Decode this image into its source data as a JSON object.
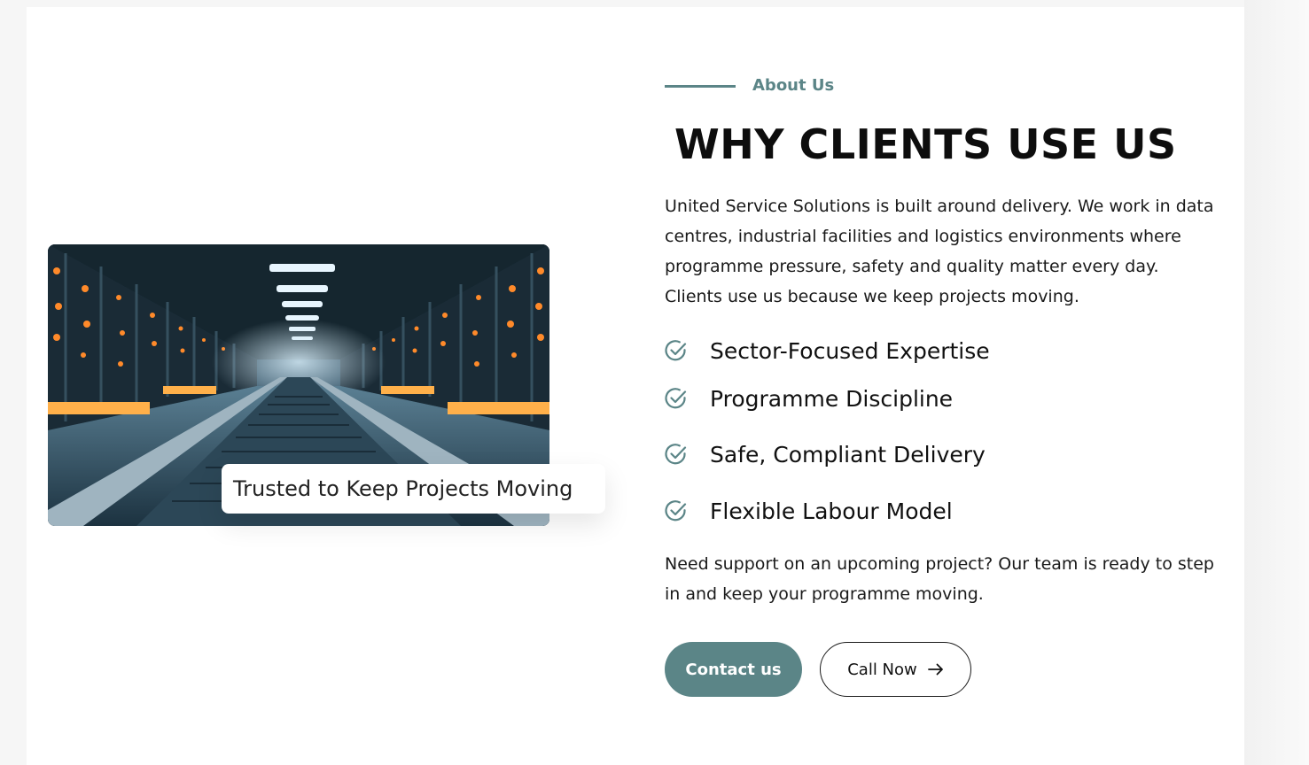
{
  "about": {
    "eyebrow": "About Us",
    "title": "WHY CLIENTS USE US",
    "intro": "United Service Solutions is built around delivery. We work in data centres, industrial facilities and logistics environments where programme pressure, safety and quality matter every day. Clients use us because we keep projects moving.",
    "features": [
      {
        "label": "Sector-Focused Expertise",
        "icon": "check-circle-icon"
      },
      {
        "label": "Programme Discipline",
        "icon": "check-circle-icon"
      },
      {
        "label": "Safe, Compliant Delivery",
        "icon": "check-circle-icon"
      },
      {
        "label": "Flexible Labour Model",
        "icon": "check-circle-icon"
      }
    ],
    "support": "Need support on an upcoming project? Our team is ready to step in and keep your programme moving."
  },
  "image": {
    "caption": "Trusted to Keep Projects Moving",
    "subject": "data-centre-corridor-photo"
  },
  "buttons": {
    "contact_label": "Contact us",
    "call_label": "Call Now",
    "call_icon": "arrow-right-icon"
  },
  "colors": {
    "accent": "#5b8587",
    "text": "#111111",
    "background": "#ffffff"
  }
}
